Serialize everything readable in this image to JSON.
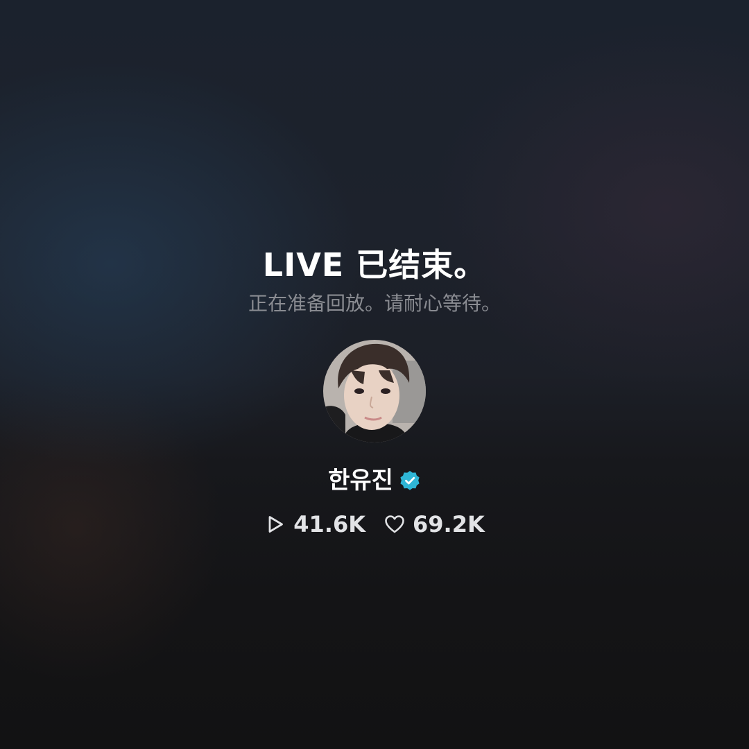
{
  "live_ended": {
    "title": "LIVE 已结束。",
    "subtitle": "正在准备回放。请耐心等待。"
  },
  "host": {
    "name": "한유진",
    "verified": true,
    "badge_color": "#2fb6d6"
  },
  "stats": {
    "views": {
      "icon": "play-icon",
      "value": "41.6K"
    },
    "likes": {
      "icon": "heart-icon",
      "value": "69.2K"
    }
  }
}
